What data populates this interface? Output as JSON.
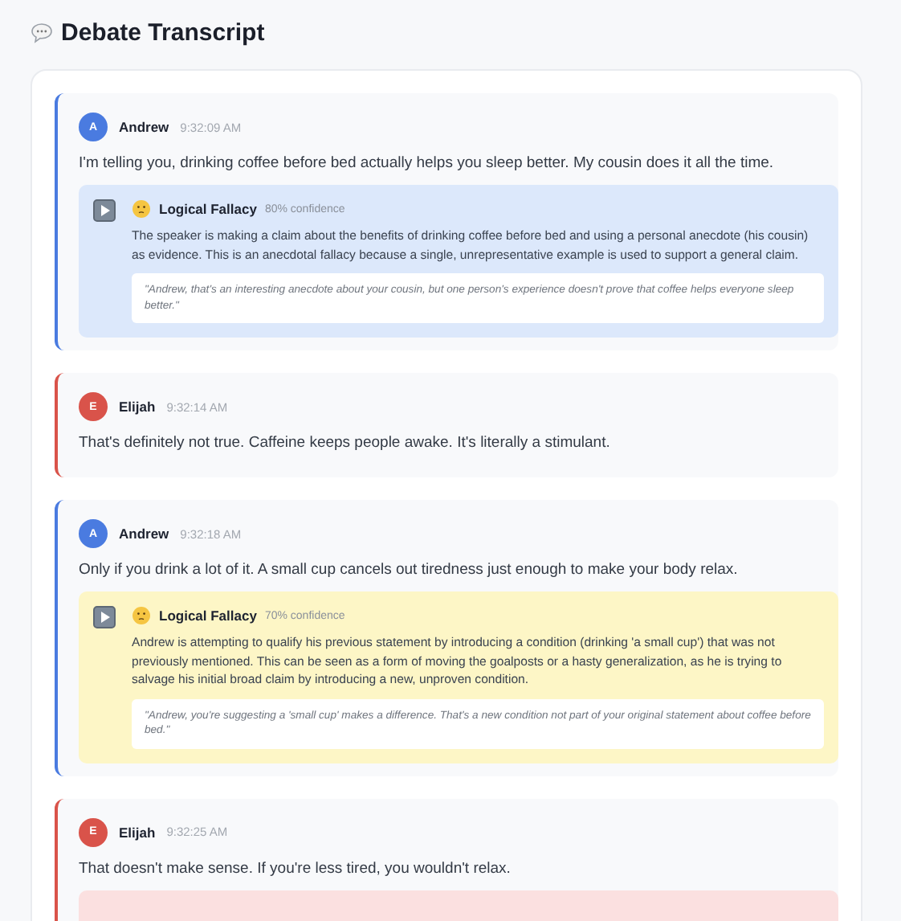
{
  "title": "Debate Transcript",
  "messages": [
    {
      "speaker": "Andrew",
      "initial": "A",
      "color": "#4a7be0",
      "time": "9:32:09 AM",
      "text": "I'm telling you, drinking coffee before bed actually helps you sleep better. My cousin does it all the time.",
      "analysis": {
        "color": "#dce8fb",
        "title": "Logical Fallacy",
        "confidence": "80% confidence",
        "explanation": "The speaker is making a claim about the benefits of drinking coffee before bed and using a personal anecdote (his cousin) as evidence. This is an anecdotal fallacy because a single, unrepresentative example is used to support a general claim.",
        "quote": "\"Andrew, that's an interesting anecdote about your cousin, but one person's experience doesn't prove that coffee helps everyone sleep better.\""
      }
    },
    {
      "speaker": "Elijah",
      "initial": "E",
      "color": "#d9534a",
      "time": "9:32:14 AM",
      "text": "That's definitely not true. Caffeine keeps people awake. It's literally a stimulant."
    },
    {
      "speaker": "Andrew",
      "initial": "A",
      "color": "#4a7be0",
      "time": "9:32:18 AM",
      "text": "Only if you drink a lot of it. A small cup cancels out tiredness just enough to make your body relax.",
      "analysis": {
        "color": "#fdf6c6",
        "title": "Logical Fallacy",
        "confidence": "70% confidence",
        "explanation": "Andrew is attempting to qualify his previous statement by introducing a condition (drinking 'a small cup') that was not previously mentioned. This can be seen as a form of moving the goalposts or a hasty generalization, as he is trying to salvage his initial broad claim by introducing a new, unproven condition.",
        "quote": "\"Andrew, you're suggesting a 'small cup' makes a difference. That's a new condition not part of your original statement about coffee before bed.\""
      }
    },
    {
      "speaker": "Elijah",
      "initial": "E",
      "color": "#d9534a",
      "time": "9:32:25 AM",
      "text": "That doesn't make sense. If you're less tired, you wouldn't relax.",
      "analysis": {
        "color": "#fbe0e0"
      }
    }
  ]
}
